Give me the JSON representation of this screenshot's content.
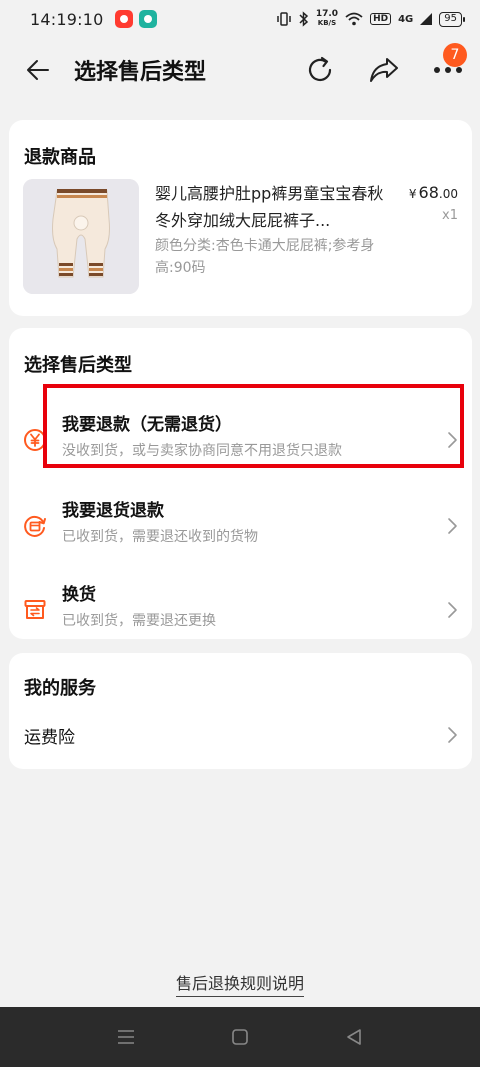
{
  "status_bar": {
    "time": "14:19:10",
    "net_speed_value": "17.0",
    "net_speed_unit": "KB/S",
    "hd": "HD",
    "signal": "4G",
    "battery": "95"
  },
  "header": {
    "title": "选择售后类型",
    "badge_count": "7"
  },
  "refund_goods": {
    "title": "退款商品",
    "product_name": "婴儿高腰护肚pp裤男童宝宝春秋冬外穿加绒大屁屁裤子...",
    "product_spec": "颜色分类:杏色卡通大屁屁裤;参考身高:90码",
    "price_symbol": "¥",
    "price_integer": "68",
    "price_decimal": ".00",
    "quantity": "x1"
  },
  "aftersale_type": {
    "title": "选择售后类型",
    "options": [
      {
        "title": "我要退款（无需退货）",
        "desc": "没收到货，或与卖家协商同意不用退货只退款"
      },
      {
        "title": "我要退货退款",
        "desc": "已收到货，需要退还收到的货物"
      },
      {
        "title": "换货",
        "desc": "已收到货，需要退还更换"
      }
    ]
  },
  "my_services": {
    "title": "我的服务",
    "items": [
      {
        "label": "运费险"
      }
    ]
  },
  "footer": {
    "rules_link": "售后退换规则说明"
  },
  "colors": {
    "accent_orange": "#ff5a1f",
    "highlight_red": "#e8000b",
    "card_bg": "#ffffff",
    "page_bg": "#f2f2f2"
  },
  "icons": {
    "back": "arrow-left-icon",
    "refresh": "refresh-icon",
    "share": "share-icon",
    "more": "more-dots-icon",
    "refund": "yen-circle-icon",
    "return_refund": "return-box-icon",
    "exchange": "exchange-box-icon",
    "chevron": "chevron-right-icon"
  }
}
